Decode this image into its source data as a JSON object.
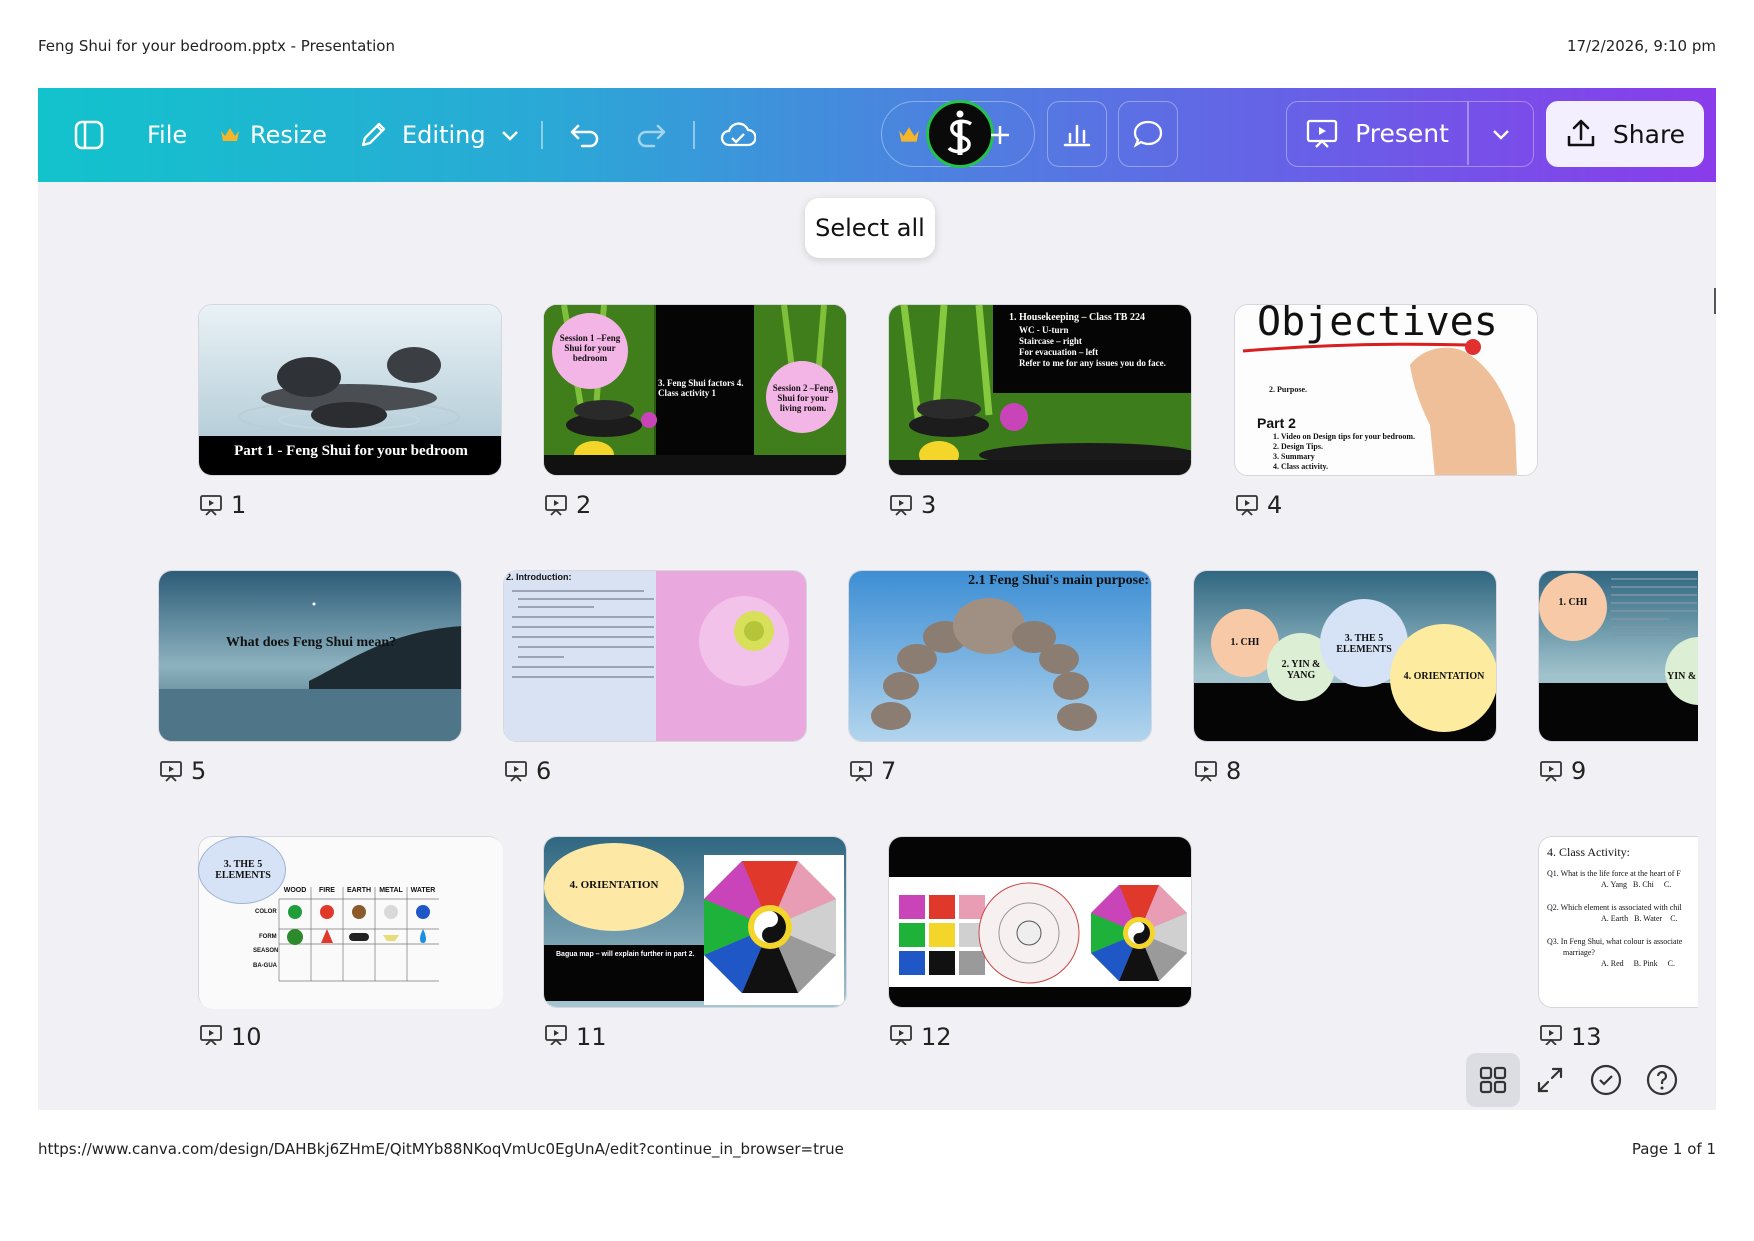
{
  "print": {
    "title": "Feng Shui for your bedroom.pptx - Presentation",
    "datetime": "17/2/2026, 9:10 pm",
    "url": "https://www.canva.com/design/DAHBkj6ZHmE/QitMYb88NKoqVmUc0EgUnA/edit?continue_in_browser=true",
    "page": "Page 1 of 1"
  },
  "toolbar": {
    "file_label": "File",
    "resize_label": "Resize",
    "editing_label": "Editing",
    "present_label": "Present",
    "share_label": "Share"
  },
  "select_all_label": "Select all",
  "slides": [
    {
      "number": "1",
      "title": "Part 1 - Feng Shui for your bedroom"
    },
    {
      "number": "2",
      "title": "Session 1 –Feng Shui for your bedroom",
      "text2": "3. Feng Shui factors 4. Class activity 1",
      "text3": "Session 2 –Feng Shui for your living room."
    },
    {
      "number": "3",
      "title": "1. Housekeeping – Class TB 224",
      "bullets": [
        "WC - U-turn",
        "Staircase – right",
        "For evacuation – left",
        "Refer to me for any issues you do face."
      ]
    },
    {
      "number": "4",
      "title": "Objectives",
      "line1": "2. Purpose.",
      "subhead": "Part 2",
      "items": [
        "1. Video on Design tips for your bedroom.",
        "2. Design Tips.",
        "3. Summary",
        "4. Class activity."
      ]
    },
    {
      "number": "5",
      "title": "What does Feng Shui mean?"
    },
    {
      "number": "6",
      "title": "2. Introduction:"
    },
    {
      "number": "7",
      "title": "2.1 Feng Shui's main purpose:"
    },
    {
      "number": "8",
      "chi": "1. CHI",
      "yin": "2. YIN & YANG",
      "elements": "3. THE 5 ELEMENTS",
      "orientation": "4. ORIENTATION"
    },
    {
      "number": "9",
      "chi": "1. CHI",
      "yin": "YIN &"
    },
    {
      "number": "10",
      "elements": "3. THE 5 ELEMENTS",
      "columns": [
        "WOOD",
        "FIRE",
        "EARTH",
        "METAL",
        "WATER"
      ],
      "rows": [
        "COLOR",
        "FORM",
        "SEASON",
        "BA-GUA"
      ]
    },
    {
      "number": "11",
      "title": "4. ORIENTATION",
      "caption": "Bagua map – will explain further in part 2."
    },
    {
      "number": "12"
    },
    {
      "number": "13",
      "title": "4. Class Activity:",
      "q1": "Q1. What is the life force at the heart of F",
      "a1": "A. Yang   B. Chi     C.",
      "q2": "Q2. Which element is associated with chil",
      "a2": "A. Earth   B. Water    C.",
      "q3": "Q3. In Feng Shui, what colour is associate",
      "q3b": "marriage?",
      "a3": "A. Red     B. Pink     C."
    }
  ],
  "colors": {
    "toolbar_start": "#12c3cc",
    "toolbar_end": "#8a3cea",
    "canvas_bg": "#f1f1f5"
  },
  "icons": [
    "sidebar-toggle-icon",
    "crown-icon",
    "pencil-icon",
    "chevron-down-icon",
    "undo-icon",
    "redo-icon",
    "cloud-check-icon",
    "plus-icon",
    "bar-chart-icon",
    "comment-icon",
    "present-icon",
    "share-upload-icon",
    "grid-view-icon",
    "expand-icon",
    "check-circle-icon",
    "help-icon",
    "slide-present-icon"
  ]
}
